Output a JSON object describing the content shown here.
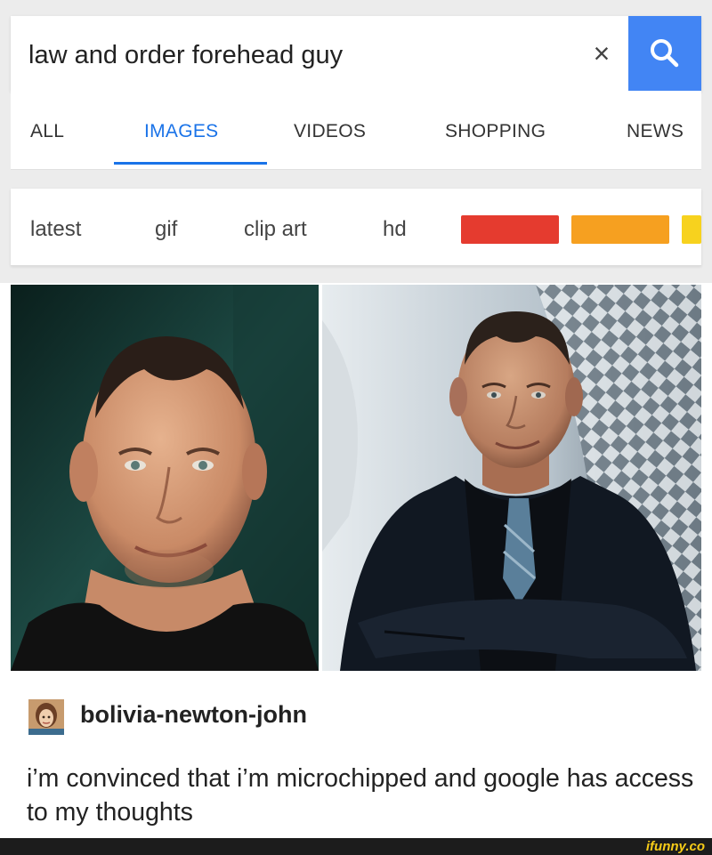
{
  "search": {
    "query": "law and order forehead guy",
    "clear_label": "×"
  },
  "tabs": [
    {
      "label": "ALL",
      "active": false
    },
    {
      "label": "IMAGES",
      "active": true
    },
    {
      "label": "VIDEOS",
      "active": false
    },
    {
      "label": "SHOPPING",
      "active": false
    },
    {
      "label": "NEWS",
      "active": false
    }
  ],
  "filters": {
    "chips": [
      "latest",
      "gif",
      "clip art",
      "hd"
    ],
    "color_swatches": [
      "#e53b2f",
      "#f6a020",
      "#f7d21e"
    ]
  },
  "icons": {
    "search": "search-icon",
    "clear": "close-icon"
  },
  "accent_color": "#4285f4",
  "post": {
    "username": "bolivia-newton-john",
    "text": "i’m convinced that i’m microchipped and google has access to my thoughts"
  },
  "footer": {
    "watermark": "ifunny.co"
  }
}
